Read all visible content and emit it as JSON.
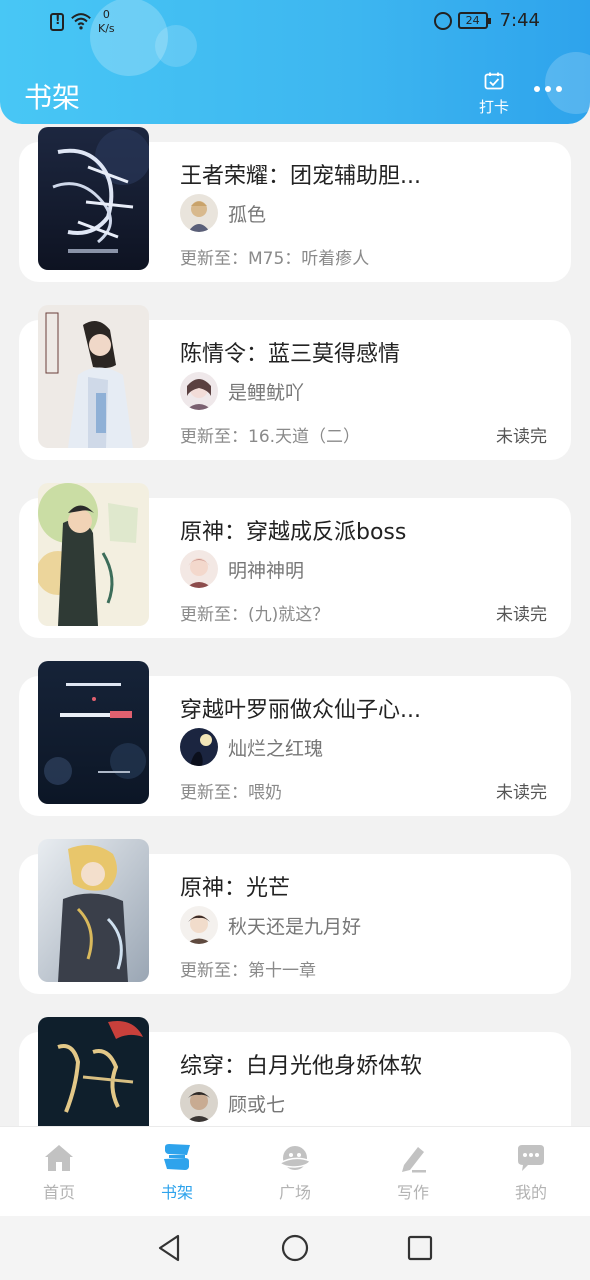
{
  "status_bar": {
    "net_speed_value": "0",
    "net_speed_unit": "K/s",
    "battery": "24",
    "time": "7:44"
  },
  "header": {
    "title": "书架",
    "checkin_label": "打卡",
    "more_icon": "more-dots-icon",
    "checkin_icon": "calendar-check-icon"
  },
  "books": [
    {
      "title": "王者荣耀：团宠辅助胆...",
      "author": "孤色",
      "update": "更新至：M75：听着瘆人",
      "status": ""
    },
    {
      "title": "陈情令：蓝三莫得感情",
      "author": "是鲤鱿吖",
      "update": "更新至：16.天道（二）",
      "status": "未读完"
    },
    {
      "title": "原神：穿越成反派boss",
      "author": "明神神明",
      "update": "更新至：(九)就这？",
      "status": "未读完"
    },
    {
      "title": "穿越叶罗丽做众仙子心...",
      "author": "灿烂之红瑰",
      "update": "更新至：喂奶",
      "status": "未读完"
    },
    {
      "title": "原神：光芒",
      "author": "秋天还是九月好",
      "update": "更新至：第十一章",
      "status": ""
    },
    {
      "title": "综穿：白月光他身娇体软",
      "author": "顾或七",
      "update": "",
      "status": ""
    }
  ],
  "tabs": [
    {
      "label": "首页",
      "icon": "home-icon",
      "active": false
    },
    {
      "label": "书架",
      "icon": "bookshelf-icon",
      "active": true
    },
    {
      "label": "广场",
      "icon": "planet-icon",
      "active": false
    },
    {
      "label": "写作",
      "icon": "pen-icon",
      "active": false
    },
    {
      "label": "我的",
      "icon": "chat-bubble-icon",
      "active": false
    }
  ],
  "colors": {
    "header_start": "#48c7f5",
    "header_end": "#2ea3ec",
    "tab_active": "#2ea3ec",
    "tab_inactive": "#b3b3b3"
  }
}
